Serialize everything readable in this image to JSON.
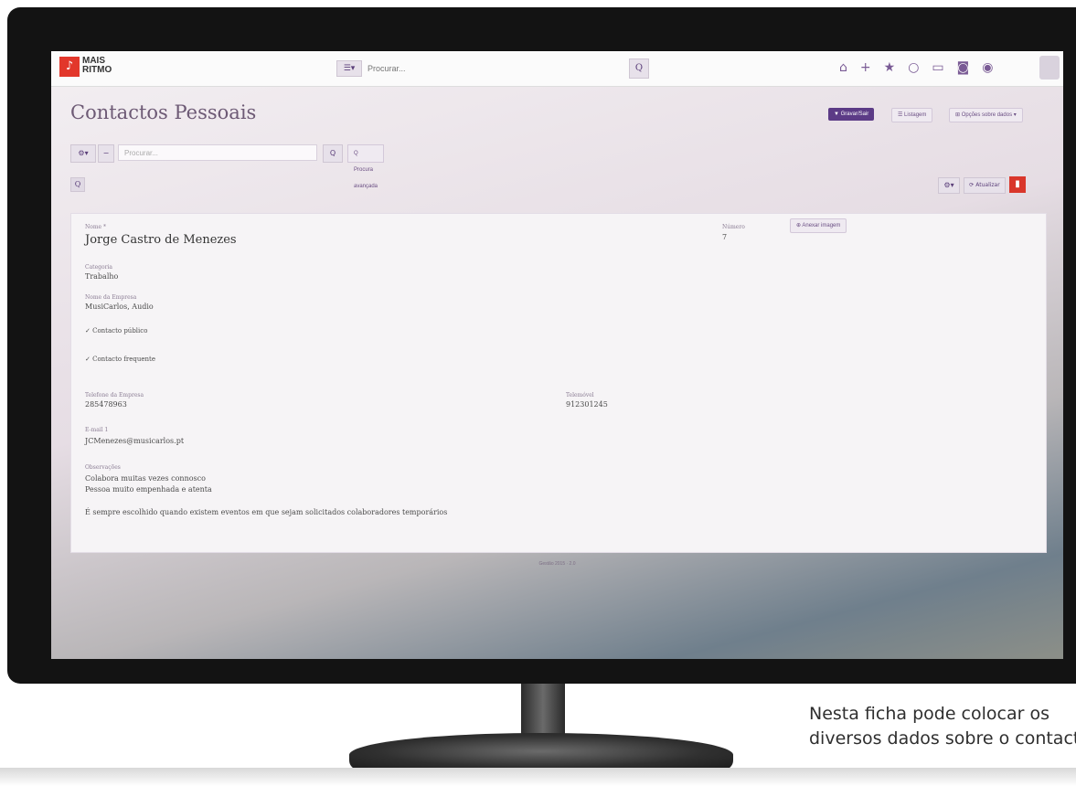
{
  "app": {
    "logo_line1": "MAIS",
    "logo_line2": "RITMO"
  },
  "topbar": {
    "menu_label": "☰▾",
    "search_placeholder": "Procurar...",
    "icons": [
      "home-icon",
      "plus-icon",
      "star-icon",
      "clock-icon",
      "calendar-icon",
      "users-icon",
      "user-icon"
    ]
  },
  "page": {
    "title": "Contactos Pessoais",
    "btn_save": "▼ Gravar/Sair",
    "btn_list": "☰ Listagem",
    "btn_options": "⊞ Opções sobre dados ▾",
    "filter_settings": "⚙▾",
    "filter_minus": "−",
    "filter_placeholder": "Procurar...",
    "filter_search": "Q",
    "advanced_search": "Q Procura avançada",
    "small_search": "Q",
    "tools_settings": "⚙▾",
    "tools_update": "⟳ Atualizar"
  },
  "form": {
    "name_label": "Nome *",
    "name": "Jorge Castro de Menezes",
    "number_label": "Número",
    "number": "7",
    "attach_label": "⊕ Anexar imagem",
    "category_label": "Categoria",
    "category": "Trabalho",
    "company_label": "Nome da Empresa",
    "company": "MusiCarlos, Audio",
    "check_public": "✓ Contacto público",
    "check_frequent": "✓ Contacto frequente",
    "phone_label": "Telefone da Empresa",
    "phone": "285478963",
    "mobile_label": "Telemóvel",
    "mobile": "912301245",
    "email_label": "E-mail 1",
    "email": "JCMenezes@musicarlos.pt",
    "notes_label": "Observações",
    "notes_line1": "Colabora muitas vezes connosco",
    "notes_line2": "Pessoa muito empenhada e atenta",
    "notes_line3": "É sempre escolhido quando existem eventos em que sejam solicitados colaboradores temporários"
  },
  "footer": {
    "text": "Gestão 2015 · 2.0"
  },
  "caption": {
    "line1": "Nesta ficha pode colocar os",
    "line2": "diversos dados sobre o contacto"
  },
  "colors": {
    "accent": "#5c3b86",
    "brand_red": "#e2372b",
    "delete": "#d9362b"
  }
}
